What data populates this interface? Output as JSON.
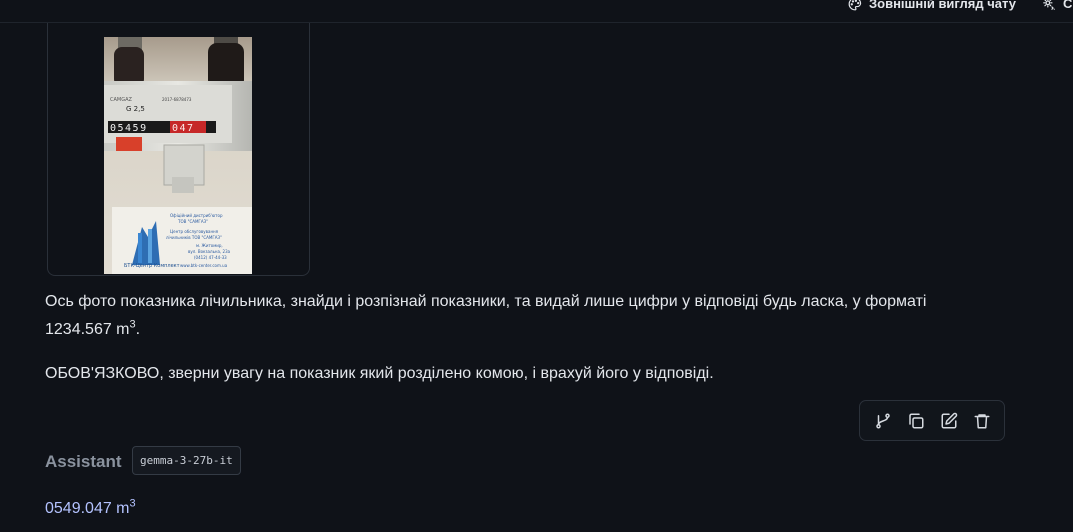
{
  "topbar": {
    "appearance_label": "Зовнішній вигляд чату",
    "second_label": "С"
  },
  "user_message": {
    "attachment": "gas-meter-photo",
    "paragraph1": "Ось фото показника лічильника, знайди і розпізнай показники, та видай лише цифри у відповіді будь ласка, у форматі 1234.567 m",
    "paragraph1_sup": "3",
    "paragraph1_end": ".",
    "paragraph2": "ОБОВ'ЯЗКОВО, зверни увагу на показник який розділено комою, і врахуй його у відповіді."
  },
  "photo": {
    "reading_black": "05459",
    "reading_red": "047",
    "model": "G 2,5",
    "label_brand": "БТК-Центр Комплект",
    "label_line1": "Офіційний дистриб'ютор",
    "label_line2": "ТОВ \"САМГАЗ\"",
    "label_line3": "Центр обслуговування",
    "label_line4": "лічильників ТОВ \"САМГАЗ\"",
    "label_line5": "м. Житомир,",
    "label_line6": "вул. Вокзальна, 23а",
    "label_line7": "(0412) 47-44-33",
    "label_line8": "www.btk-center.com.ua"
  },
  "actions": [
    "branch-icon",
    "copy-icon",
    "edit-icon",
    "trash-icon"
  ],
  "assistant": {
    "label": "Assistant",
    "model": "gemma-3-27b-it",
    "reply": "0549.047 m",
    "reply_sup": "3"
  },
  "colors": {
    "background": "#0f1218",
    "text": "#e3e6eb",
    "reply_text": "#b4c3ff",
    "muted": "#8a929e"
  }
}
